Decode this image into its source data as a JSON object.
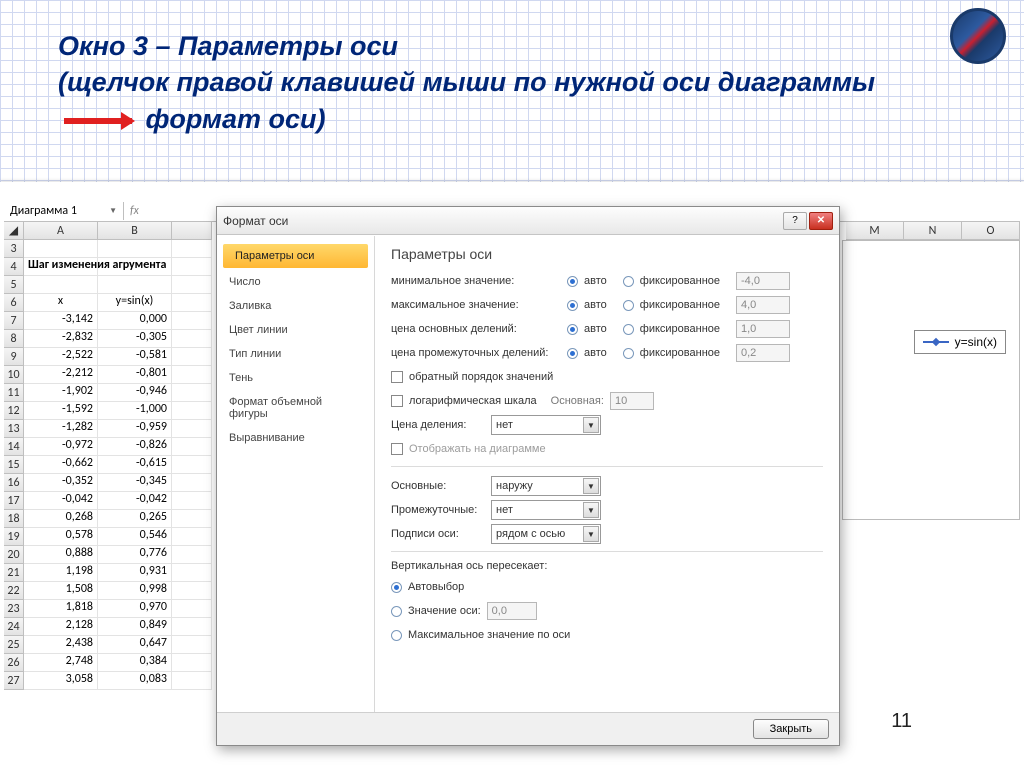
{
  "slide": {
    "title_l1": "Окно 3 – Параметры оси",
    "title_l2a": "(щелчок правой клавишей мыши по нужной оси диаграммы",
    "title_l2b": "формат оси)",
    "page_number": "11"
  },
  "excel": {
    "name_box": "Диаграмма 1",
    "fx_symbol": "fx",
    "col_left": [
      "A",
      "B"
    ],
    "col_right": [
      "M",
      "N",
      "O"
    ],
    "header_row": {
      "label": "Шаг изменения агрумента",
      "rownum": "4"
    },
    "row5": "5",
    "th_row": {
      "num": "6",
      "x": "x",
      "y": "y=sin(x)"
    },
    "rows": [
      {
        "n": "7",
        "x": "-3,142",
        "y": "0,000"
      },
      {
        "n": "8",
        "x": "-2,832",
        "y": "-0,305"
      },
      {
        "n": "9",
        "x": "-2,522",
        "y": "-0,581"
      },
      {
        "n": "10",
        "x": "-2,212",
        "y": "-0,801"
      },
      {
        "n": "11",
        "x": "-1,902",
        "y": "-0,946"
      },
      {
        "n": "12",
        "x": "-1,592",
        "y": "-1,000"
      },
      {
        "n": "13",
        "x": "-1,282",
        "y": "-0,959"
      },
      {
        "n": "14",
        "x": "-0,972",
        "y": "-0,826"
      },
      {
        "n": "15",
        "x": "-0,662",
        "y": "-0,615"
      },
      {
        "n": "16",
        "x": "-0,352",
        "y": "-0,345"
      },
      {
        "n": "17",
        "x": "-0,042",
        "y": "-0,042"
      },
      {
        "n": "18",
        "x": "0,268",
        "y": "0,265"
      },
      {
        "n": "19",
        "x": "0,578",
        "y": "0,546"
      },
      {
        "n": "20",
        "x": "0,888",
        "y": "0,776"
      },
      {
        "n": "21",
        "x": "1,198",
        "y": "0,931"
      },
      {
        "n": "22",
        "x": "1,508",
        "y": "0,998"
      },
      {
        "n": "23",
        "x": "1,818",
        "y": "0,970"
      },
      {
        "n": "24",
        "x": "2,128",
        "y": "0,849"
      },
      {
        "n": "25",
        "x": "2,438",
        "y": "0,647"
      },
      {
        "n": "26",
        "x": "2,748",
        "y": "0,384"
      },
      {
        "n": "27",
        "x": "3,058",
        "y": "0,083"
      }
    ],
    "row3": "3",
    "legend": "y=sin(x)"
  },
  "dialog": {
    "title": "Формат оси",
    "help": "?",
    "close": "✕",
    "categories": [
      "Параметры оси",
      "Число",
      "Заливка",
      "Цвет линии",
      "Тип линии",
      "Тень",
      "Формат объемной фигуры",
      "Выравнивание"
    ],
    "panel_title": "Параметры оси",
    "rows": {
      "min": {
        "label": "минимальное значение:",
        "auto": "авто",
        "fixed": "фиксированное",
        "val": "-4,0"
      },
      "max": {
        "label": "максимальное значение:",
        "auto": "авто",
        "fixed": "фиксированное",
        "val": "4,0"
      },
      "major": {
        "label": "цена основных делений:",
        "auto": "авто",
        "fixed": "фиксированное",
        "val": "1,0"
      },
      "minor": {
        "label": "цена промежуточных делений:",
        "auto": "авто",
        "fixed": "фиксированное",
        "val": "0,2"
      }
    },
    "reverse": "обратный порядок значений",
    "log": "логарифмическая шкала",
    "log_base_lbl": "Основная:",
    "log_base_val": "10",
    "unit_lbl": "Цена деления:",
    "unit_val": "нет",
    "show_on_chart": "Отображать на диаграмме",
    "major_ticks_lbl": "Основные:",
    "major_ticks_val": "наружу",
    "minor_ticks_lbl": "Промежуточные:",
    "minor_ticks_val": "нет",
    "axis_labels_lbl": "Подписи оси:",
    "axis_labels_val": "рядом с осью",
    "cross_title": "Вертикальная ось пересекает:",
    "cross_auto": "Автовыбор",
    "cross_val_lbl": "Значение оси:",
    "cross_val": "0,0",
    "cross_max": "Максимальное значение по оси",
    "close_btn": "Закрыть"
  }
}
